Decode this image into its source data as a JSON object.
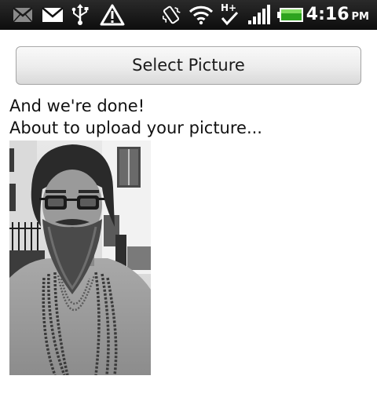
{
  "status_bar": {
    "icons": [
      "gmail-icon",
      "mail-icon",
      "usb-icon",
      "warning-icon",
      "vibrate-icon",
      "wifi-icon",
      "h-plus-network-icon",
      "signal-icon",
      "battery-icon"
    ],
    "time": "4:16",
    "ampm": "PM",
    "background": "#111111"
  },
  "main": {
    "select_button_label": "Select Picture",
    "status_line_1": "And we're done!",
    "status_line_2": "About to upload your picture...",
    "picture": {
      "description_icon": "uploaded-photo"
    }
  }
}
